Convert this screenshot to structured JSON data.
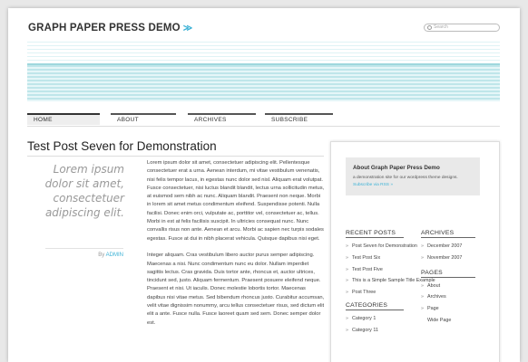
{
  "header": {
    "site_title": "GRAPH PAPER PRESS DEMO",
    "title_arrow": "≫",
    "search_placeholder": "Search"
  },
  "nav": {
    "items": [
      "HOME",
      "ABOUT",
      "ARCHIVES",
      "SUBSCRIBE"
    ],
    "active": "HOME"
  },
  "post": {
    "title": "Test Post Seven for Demonstration",
    "pullquote": "Lorem ipsum dolor sit amet, consectetuer adipiscing elit.",
    "byline_prefix": "By",
    "author": "ADMIN",
    "paragraph1": "Lorem ipsum dolor sit amet, consectetuer adipiscing elit. Pellentesque consectetuer erat a urna. Aenean interdum, mi vitae vestibulum venenatis, nisi felis tempor lacus, in egestas nunc dolor sed nisl. Aliquam erat volutpat. Fusce consectetuer, nisi luctus blandit blandit, lectus urna sollicitudin metus, at euismod sem nibh ac nunc. Aliquam blandit. Praesent non neque. Morbi in lorem sit amet metus condimentum eleifend. Suspendisse potenti. Nulla facilisi. Donec enim orci, vulputate ac, porttitor vel, consectetuer ac, tellus. Morbi in est at felis facilisis suscipit. In ultricies consequat nunc. Nunc convallis risus non ante. Aenean et arcu. Morbi ac sapien nec turpis sodales egestas. Fusce at dui in nibh placerat vehicula. Quisque dapibus nisi eget.",
    "paragraph2": "Integer aliquam. Cras vestibulum libero auctor purus semper adipiscing. Maecenas a nisi. Nunc condimentum nunc eu dolor. Nullam imperdiet sagittis lectus. Cras gravida. Duis tortor ante, rhoncus et, auctor ultrices, tincidunt sed, justo. Aliquam fermentum. Praesent posuere eleifend neque. Praesent et nisi. Ut iaculis. Donec molestie lobortis tortor. Maecenas dapibus nisi vitae metus. Sed bibendum rhoncus justo. Curabitur accumsan, velit vitae dignissim nonummy, arcu tellus consectetuer risus, sed dictum elit elit a ante. Fusce nulla. Fusce laoreet quam sed sem. Donec semper dolor est."
  },
  "sidebar": {
    "about": {
      "heading": "About Graph Paper Press Demo",
      "text": "a demonstration site for our wordpress theme designs.",
      "link": "Subscribe via RSS »"
    },
    "recent_posts": {
      "heading": "RECENT POSTS",
      "items": [
        "Post Seven for Demonstration",
        "Test Post Six",
        "Test Post Five",
        "This is a Simple Sample Title Example",
        "Post Three"
      ]
    },
    "archives": {
      "heading": "ARCHIVES",
      "items": [
        "December 2007",
        "November 2007"
      ]
    },
    "pages": {
      "heading": "PAGES",
      "items": [
        "About",
        "Archives",
        "Page"
      ],
      "subitems": [
        "Wide Page"
      ]
    },
    "categories": {
      "heading": "CATEGORIES",
      "items": [
        "Category 1",
        "Category 11"
      ]
    }
  }
}
